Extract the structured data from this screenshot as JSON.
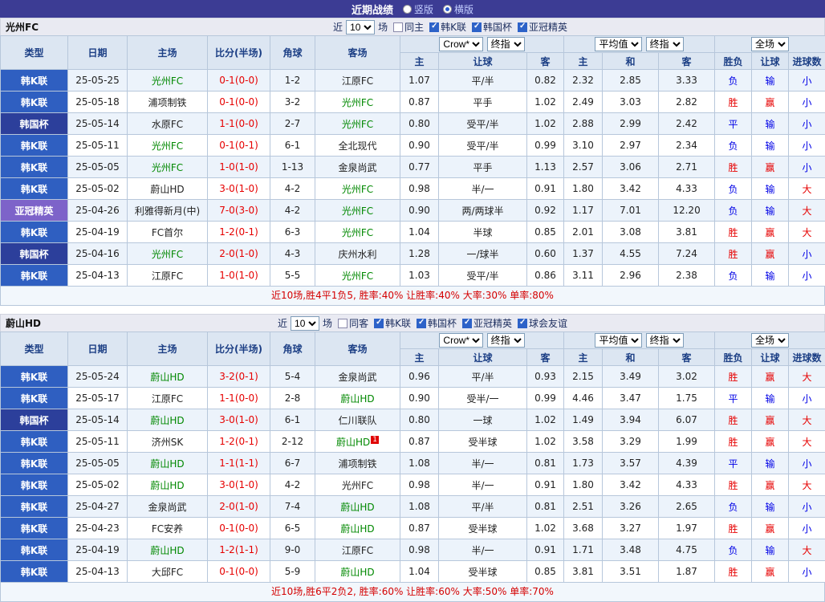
{
  "topbar": {
    "title": "近期战绩",
    "radio_vertical": "竖版",
    "radio_horizontal": "横版",
    "vertical_checked": false,
    "horizontal_checked": true
  },
  "table": {
    "columns": {
      "type": "类型",
      "date": "日期",
      "home": "主场",
      "score": "比分(半场)",
      "corners": "角球",
      "away": "客场",
      "odds_home": "主",
      "handicap": "让球",
      "odds_away": "客",
      "avg_home": "主",
      "avg_draw": "和",
      "avg_away": "客",
      "result": "胜负",
      "handicap_result": "让球",
      "goals": "进球数"
    },
    "dropdowns": {
      "bookmaker": "Crow*",
      "final_odds": "终指",
      "average": "平均值",
      "final_avg": "终指",
      "full_match": "全场"
    }
  },
  "colors": {
    "league": {
      "韩K联": "#2f5fc1",
      "韩国杯": "#2c3f9b",
      "亚冠精英": "#7d63c9"
    },
    "win": "#e60000",
    "loss": "#0000e6",
    "focus_team": "#008800",
    "score": "#e60000",
    "topbar_bg": "#3c3c94"
  },
  "sections": [
    {
      "team": "光州FC",
      "filters": {
        "near_label": "近",
        "near_value": "10",
        "matches_label": "场",
        "same": {
          "label": "同主",
          "checked": false
        },
        "leagues": [
          {
            "label": "韩K联",
            "checked": true
          },
          {
            "label": "韩国杯",
            "checked": true
          },
          {
            "label": "亚冠精英",
            "checked": true
          }
        ]
      },
      "rows": [
        {
          "league": "韩K联",
          "date": "25-05-25",
          "home": "光州FC",
          "home_focus": true,
          "score": "0-1(0-0)",
          "corners": "1-2",
          "away": "江原FC",
          "odds_home": "1.07",
          "handicap": "平/半",
          "odds_away": "0.82",
          "avg_home": "2.32",
          "avg_draw": "2.85",
          "avg_away": "3.33",
          "result": "负",
          "handicap_result": "输",
          "goals": "小"
        },
        {
          "league": "韩K联",
          "date": "25-05-18",
          "home": "浦项制铁",
          "score": "0-1(0-0)",
          "corners": "3-2",
          "away": "光州FC",
          "away_focus": true,
          "odds_home": "0.87",
          "handicap": "平手",
          "odds_away": "1.02",
          "avg_home": "2.49",
          "avg_draw": "3.03",
          "avg_away": "2.82",
          "result": "胜",
          "handicap_result": "赢",
          "goals": "小"
        },
        {
          "league": "韩国杯",
          "date": "25-05-14",
          "home": "水原FC",
          "score": "1-1(0-0)",
          "corners": "2-7",
          "away": "光州FC",
          "away_focus": true,
          "odds_home": "0.80",
          "handicap": "受平/半",
          "odds_away": "1.02",
          "avg_home": "2.88",
          "avg_draw": "2.99",
          "avg_away": "2.42",
          "result": "平",
          "handicap_result": "输",
          "goals": "小"
        },
        {
          "league": "韩K联",
          "date": "25-05-11",
          "home": "光州FC",
          "home_focus": true,
          "score": "0-1(0-1)",
          "corners": "6-1",
          "away": "全北现代",
          "odds_home": "0.90",
          "handicap": "受平/半",
          "odds_away": "0.99",
          "avg_home": "3.10",
          "avg_draw": "2.97",
          "avg_away": "2.34",
          "result": "负",
          "handicap_result": "输",
          "goals": "小"
        },
        {
          "league": "韩K联",
          "date": "25-05-05",
          "home": "光州FC",
          "home_focus": true,
          "score": "1-0(1-0)",
          "corners": "1-13",
          "away": "金泉尚武",
          "odds_home": "0.77",
          "handicap": "平手",
          "odds_away": "1.13",
          "avg_home": "2.57",
          "avg_draw": "3.06",
          "avg_away": "2.71",
          "result": "胜",
          "handicap_result": "赢",
          "goals": "小"
        },
        {
          "league": "韩K联",
          "date": "25-05-02",
          "home": "蔚山HD",
          "score": "3-0(1-0)",
          "corners": "4-2",
          "away": "光州FC",
          "away_focus": true,
          "odds_home": "0.98",
          "handicap": "半/一",
          "odds_away": "0.91",
          "avg_home": "1.80",
          "avg_draw": "3.42",
          "avg_away": "4.33",
          "result": "负",
          "handicap_result": "输",
          "goals": "大"
        },
        {
          "league": "亚冠精英",
          "date": "25-04-26",
          "home": "利雅得新月(中)",
          "score": "7-0(3-0)",
          "corners": "4-2",
          "away": "光州FC",
          "away_focus": true,
          "odds_home": "0.90",
          "handicap": "两/两球半",
          "odds_away": "0.92",
          "avg_home": "1.17",
          "avg_draw": "7.01",
          "avg_away": "12.20",
          "result": "负",
          "handicap_result": "输",
          "goals": "大"
        },
        {
          "league": "韩K联",
          "date": "25-04-19",
          "home": "FC首尔",
          "score": "1-2(0-1)",
          "corners": "6-3",
          "away": "光州FC",
          "away_focus": true,
          "odds_home": "1.04",
          "handicap": "半球",
          "odds_away": "0.85",
          "avg_home": "2.01",
          "avg_draw": "3.08",
          "avg_away": "3.81",
          "result": "胜",
          "handicap_result": "赢",
          "goals": "大"
        },
        {
          "league": "韩国杯",
          "date": "25-04-16",
          "home": "光州FC",
          "home_focus": true,
          "score": "2-0(1-0)",
          "corners": "4-3",
          "away": "庆州水利",
          "odds_home": "1.28",
          "handicap": "一/球半",
          "odds_away": "0.60",
          "avg_home": "1.37",
          "avg_draw": "4.55",
          "avg_away": "7.24",
          "result": "胜",
          "handicap_result": "赢",
          "goals": "小"
        },
        {
          "league": "韩K联",
          "date": "25-04-13",
          "home": "江原FC",
          "score": "1-0(1-0)",
          "corners": "5-5",
          "away": "光州FC",
          "away_focus": true,
          "odds_home": "1.03",
          "handicap": "受平/半",
          "odds_away": "0.86",
          "avg_home": "3.11",
          "avg_draw": "2.96",
          "avg_away": "2.38",
          "result": "负",
          "handicap_result": "输",
          "goals": "小"
        }
      ],
      "summary": "近10场,胜4平1负5, 胜率:40% 让胜率:40% 大率:30% 单率:80%"
    },
    {
      "team": "蔚山HD",
      "filters": {
        "near_label": "近",
        "near_value": "10",
        "matches_label": "场",
        "same": {
          "label": "同客",
          "checked": false
        },
        "leagues": [
          {
            "label": "韩K联",
            "checked": true
          },
          {
            "label": "韩国杯",
            "checked": true
          },
          {
            "label": "亚冠精英",
            "checked": true
          },
          {
            "label": "球会友谊",
            "checked": true
          }
        ]
      },
      "rows": [
        {
          "league": "韩K联",
          "date": "25-05-24",
          "home": "蔚山HD",
          "home_focus": true,
          "score": "3-2(0-1)",
          "corners": "5-4",
          "away": "金泉尚武",
          "odds_home": "0.96",
          "handicap": "平/半",
          "odds_away": "0.93",
          "avg_home": "2.15",
          "avg_draw": "3.49",
          "avg_away": "3.02",
          "result": "胜",
          "handicap_result": "赢",
          "goals": "大"
        },
        {
          "league": "韩K联",
          "date": "25-05-17",
          "home": "江原FC",
          "score": "1-1(0-0)",
          "corners": "2-8",
          "away": "蔚山HD",
          "away_focus": true,
          "odds_home": "0.90",
          "handicap": "受半/一",
          "odds_away": "0.99",
          "avg_home": "4.46",
          "avg_draw": "3.47",
          "avg_away": "1.75",
          "result": "平",
          "handicap_result": "输",
          "goals": "小"
        },
        {
          "league": "韩国杯",
          "date": "25-05-14",
          "home": "蔚山HD",
          "home_focus": true,
          "score": "3-0(1-0)",
          "corners": "6-1",
          "away": "仁川联队",
          "odds_home": "0.80",
          "handicap": "一球",
          "odds_away": "1.02",
          "avg_home": "1.49",
          "avg_draw": "3.94",
          "avg_away": "6.07",
          "result": "胜",
          "handicap_result": "赢",
          "goals": "大"
        },
        {
          "league": "韩K联",
          "date": "25-05-11",
          "home": "济州SK",
          "score": "1-2(0-1)",
          "corners": "2-12",
          "away": "蔚山HD",
          "away_focus": true,
          "away_badge": "1",
          "odds_home": "0.87",
          "handicap": "受半球",
          "odds_away": "1.02",
          "avg_home": "3.58",
          "avg_draw": "3.29",
          "avg_away": "1.99",
          "result": "胜",
          "handicap_result": "赢",
          "goals": "大"
        },
        {
          "league": "韩K联",
          "date": "25-05-05",
          "home": "蔚山HD",
          "home_focus": true,
          "score": "1-1(1-1)",
          "corners": "6-7",
          "away": "浦项制铁",
          "odds_home": "1.08",
          "handicap": "半/一",
          "odds_away": "0.81",
          "avg_home": "1.73",
          "avg_draw": "3.57",
          "avg_away": "4.39",
          "result": "平",
          "handicap_result": "输",
          "goals": "小"
        },
        {
          "league": "韩K联",
          "date": "25-05-02",
          "home": "蔚山HD",
          "home_focus": true,
          "score": "3-0(1-0)",
          "corners": "4-2",
          "away": "光州FC",
          "odds_home": "0.98",
          "handicap": "半/一",
          "odds_away": "0.91",
          "avg_home": "1.80",
          "avg_draw": "3.42",
          "avg_away": "4.33",
          "result": "胜",
          "handicap_result": "赢",
          "goals": "大"
        },
        {
          "league": "韩K联",
          "date": "25-04-27",
          "home": "金泉尚武",
          "score": "2-0(1-0)",
          "corners": "7-4",
          "away": "蔚山HD",
          "away_focus": true,
          "odds_home": "1.08",
          "handicap": "平/半",
          "odds_away": "0.81",
          "avg_home": "2.51",
          "avg_draw": "3.26",
          "avg_away": "2.65",
          "result": "负",
          "handicap_result": "输",
          "goals": "小"
        },
        {
          "league": "韩K联",
          "date": "25-04-23",
          "home": "FC安养",
          "score": "0-1(0-0)",
          "corners": "6-5",
          "away": "蔚山HD",
          "away_focus": true,
          "odds_home": "0.87",
          "handicap": "受半球",
          "odds_away": "1.02",
          "avg_home": "3.68",
          "avg_draw": "3.27",
          "avg_away": "1.97",
          "result": "胜",
          "handicap_result": "赢",
          "goals": "小"
        },
        {
          "league": "韩K联",
          "date": "25-04-19",
          "home": "蔚山HD",
          "home_focus": true,
          "score": "1-2(1-1)",
          "corners": "9-0",
          "away": "江原FC",
          "odds_home": "0.98",
          "handicap": "半/一",
          "odds_away": "0.91",
          "avg_home": "1.71",
          "avg_draw": "3.48",
          "avg_away": "4.75",
          "result": "负",
          "handicap_result": "输",
          "goals": "大"
        },
        {
          "league": "韩K联",
          "date": "25-04-13",
          "home": "大邱FC",
          "score": "0-1(0-0)",
          "corners": "5-9",
          "away": "蔚山HD",
          "away_focus": true,
          "odds_home": "1.04",
          "handicap": "受半球",
          "odds_away": "0.85",
          "avg_home": "3.81",
          "avg_draw": "3.51",
          "avg_away": "1.87",
          "result": "胜",
          "handicap_result": "赢",
          "goals": "小"
        }
      ],
      "summary": "近10场,胜6平2负2, 胜率:60% 让胜率:60% 大率:50% 单率:70%"
    }
  ]
}
